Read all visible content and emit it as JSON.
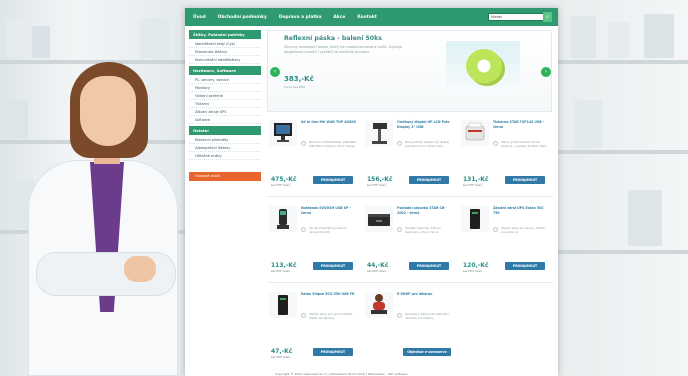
{
  "nav": {
    "items": [
      "Úvod",
      "Obchodní podmínky",
      "Doprava a platba",
      "Akce",
      "Kontakt"
    ],
    "search_value": "Hledej"
  },
  "sidebar": {
    "sections": [
      {
        "title": "Štítky, Pokladní potřeby",
        "links": [
          "Identifikační kódy (Cyb)",
          "Ekonomika lékárny",
          "Komunikační identifikátory"
        ]
      },
      {
        "title": "Hardware, Software",
        "links": [
          "PC, servery, stanice",
          "Monitory",
          "Výdejní periferie",
          "Tiskárny",
          "Záložní zdroje UPS",
          "Software"
        ]
      },
      {
        "title": "Ostatní",
        "links": [
          "Reklamní předměty",
          "Zabezpečení lékárny",
          "Užitečné služby"
        ]
      }
    ],
    "promo": "Vzorové zboží"
  },
  "hero": {
    "title": "Reflexní páska - balení 50ks",
    "description": "Škrovný samolepící pásek, který lze snadno lemovat a tvořit. Zvyšuje bezpečnost chodců i cyklistů ve silničním provozu.",
    "price": "383,-Kč",
    "price_note": "Cena bez DPH",
    "arrow_left": "‹",
    "arrow_right": "›"
  },
  "products": [
    {
      "name": "All in One MO W4D TOP 4G500",
      "desc": "Pentium G7200 Pameti, 2GB RAM, 500 HDD, Graphics, 18.5\" displej",
      "price": "475,-Kč",
      "note": "bez DPH měsíc",
      "button": "PRONAJMOUT"
    },
    {
      "name": "Čtečkový displej HP LCD Pole Display 2\" USB",
      "desc": "Pole grafický zákaznický displej, zobrazení dvou řádků textu",
      "price": "156,-Kč",
      "note": "bez DPH měsíc",
      "button": "PRONAJMOUT"
    },
    {
      "name": "Tiskárna STAR TSP143 USB - černá",
      "desc": "Velmi rychlá pokladní termo tiskárna s vysokou kvalitou tisku",
      "price": "131,-Kč",
      "note": "bez DPH měsíc",
      "button": "PRONAJMOUT"
    },
    {
      "name": "Notebook EXVOSH USB XP - černá",
      "desc": "2D mnohosměrový snímač čárových kódů",
      "price": "113,-Kč",
      "note": "bez DPH měsíc",
      "button": "PRONAJMOUT"
    },
    {
      "name": "Pokladní zásuvka STAR CB-2002 - černá",
      "desc": "Pokladní zásuvka, 5/8 pro bankovky a 8 pro mince",
      "price": "44,-Kč",
      "note": "bez DPH měsíc",
      "button": "PRONAJMOUT"
    },
    {
      "name": "Záložní zdroj UPS Eaton 5SC 750",
      "desc": "Záložní zdroj pro server, 750VA, pro jeden pc",
      "price": "120,-Kč",
      "note": "bez DPH měsíc",
      "button": "PRONAJMOUT"
    },
    {
      "name": "Eaton Ellipse ECO 550 USB FR",
      "desc": "Záložní zdroj pro server 550VA, 330W, 4x zásuvky",
      "price": "47,-Kč",
      "note": "bez DPH měsíc",
      "button": "PRONAJMOUT"
    },
    {
      "name": "E-SHOP pro lékárnu",
      "desc": "Kompletní řešení internetového obchodu pro lékárny",
      "price": "",
      "note": "",
      "button": "Objednat e-commerce"
    }
  ],
  "footer": "Copyright © 2016 www.lekarna.cz | Aktualizace 30.03.2016 | Webmaster - SKC software",
  "colors": {
    "nav_green": "#2f9a6f",
    "button_blue": "#2f79a8",
    "price_teal": "#2a8b85",
    "promo_orange": "#e8662e"
  }
}
